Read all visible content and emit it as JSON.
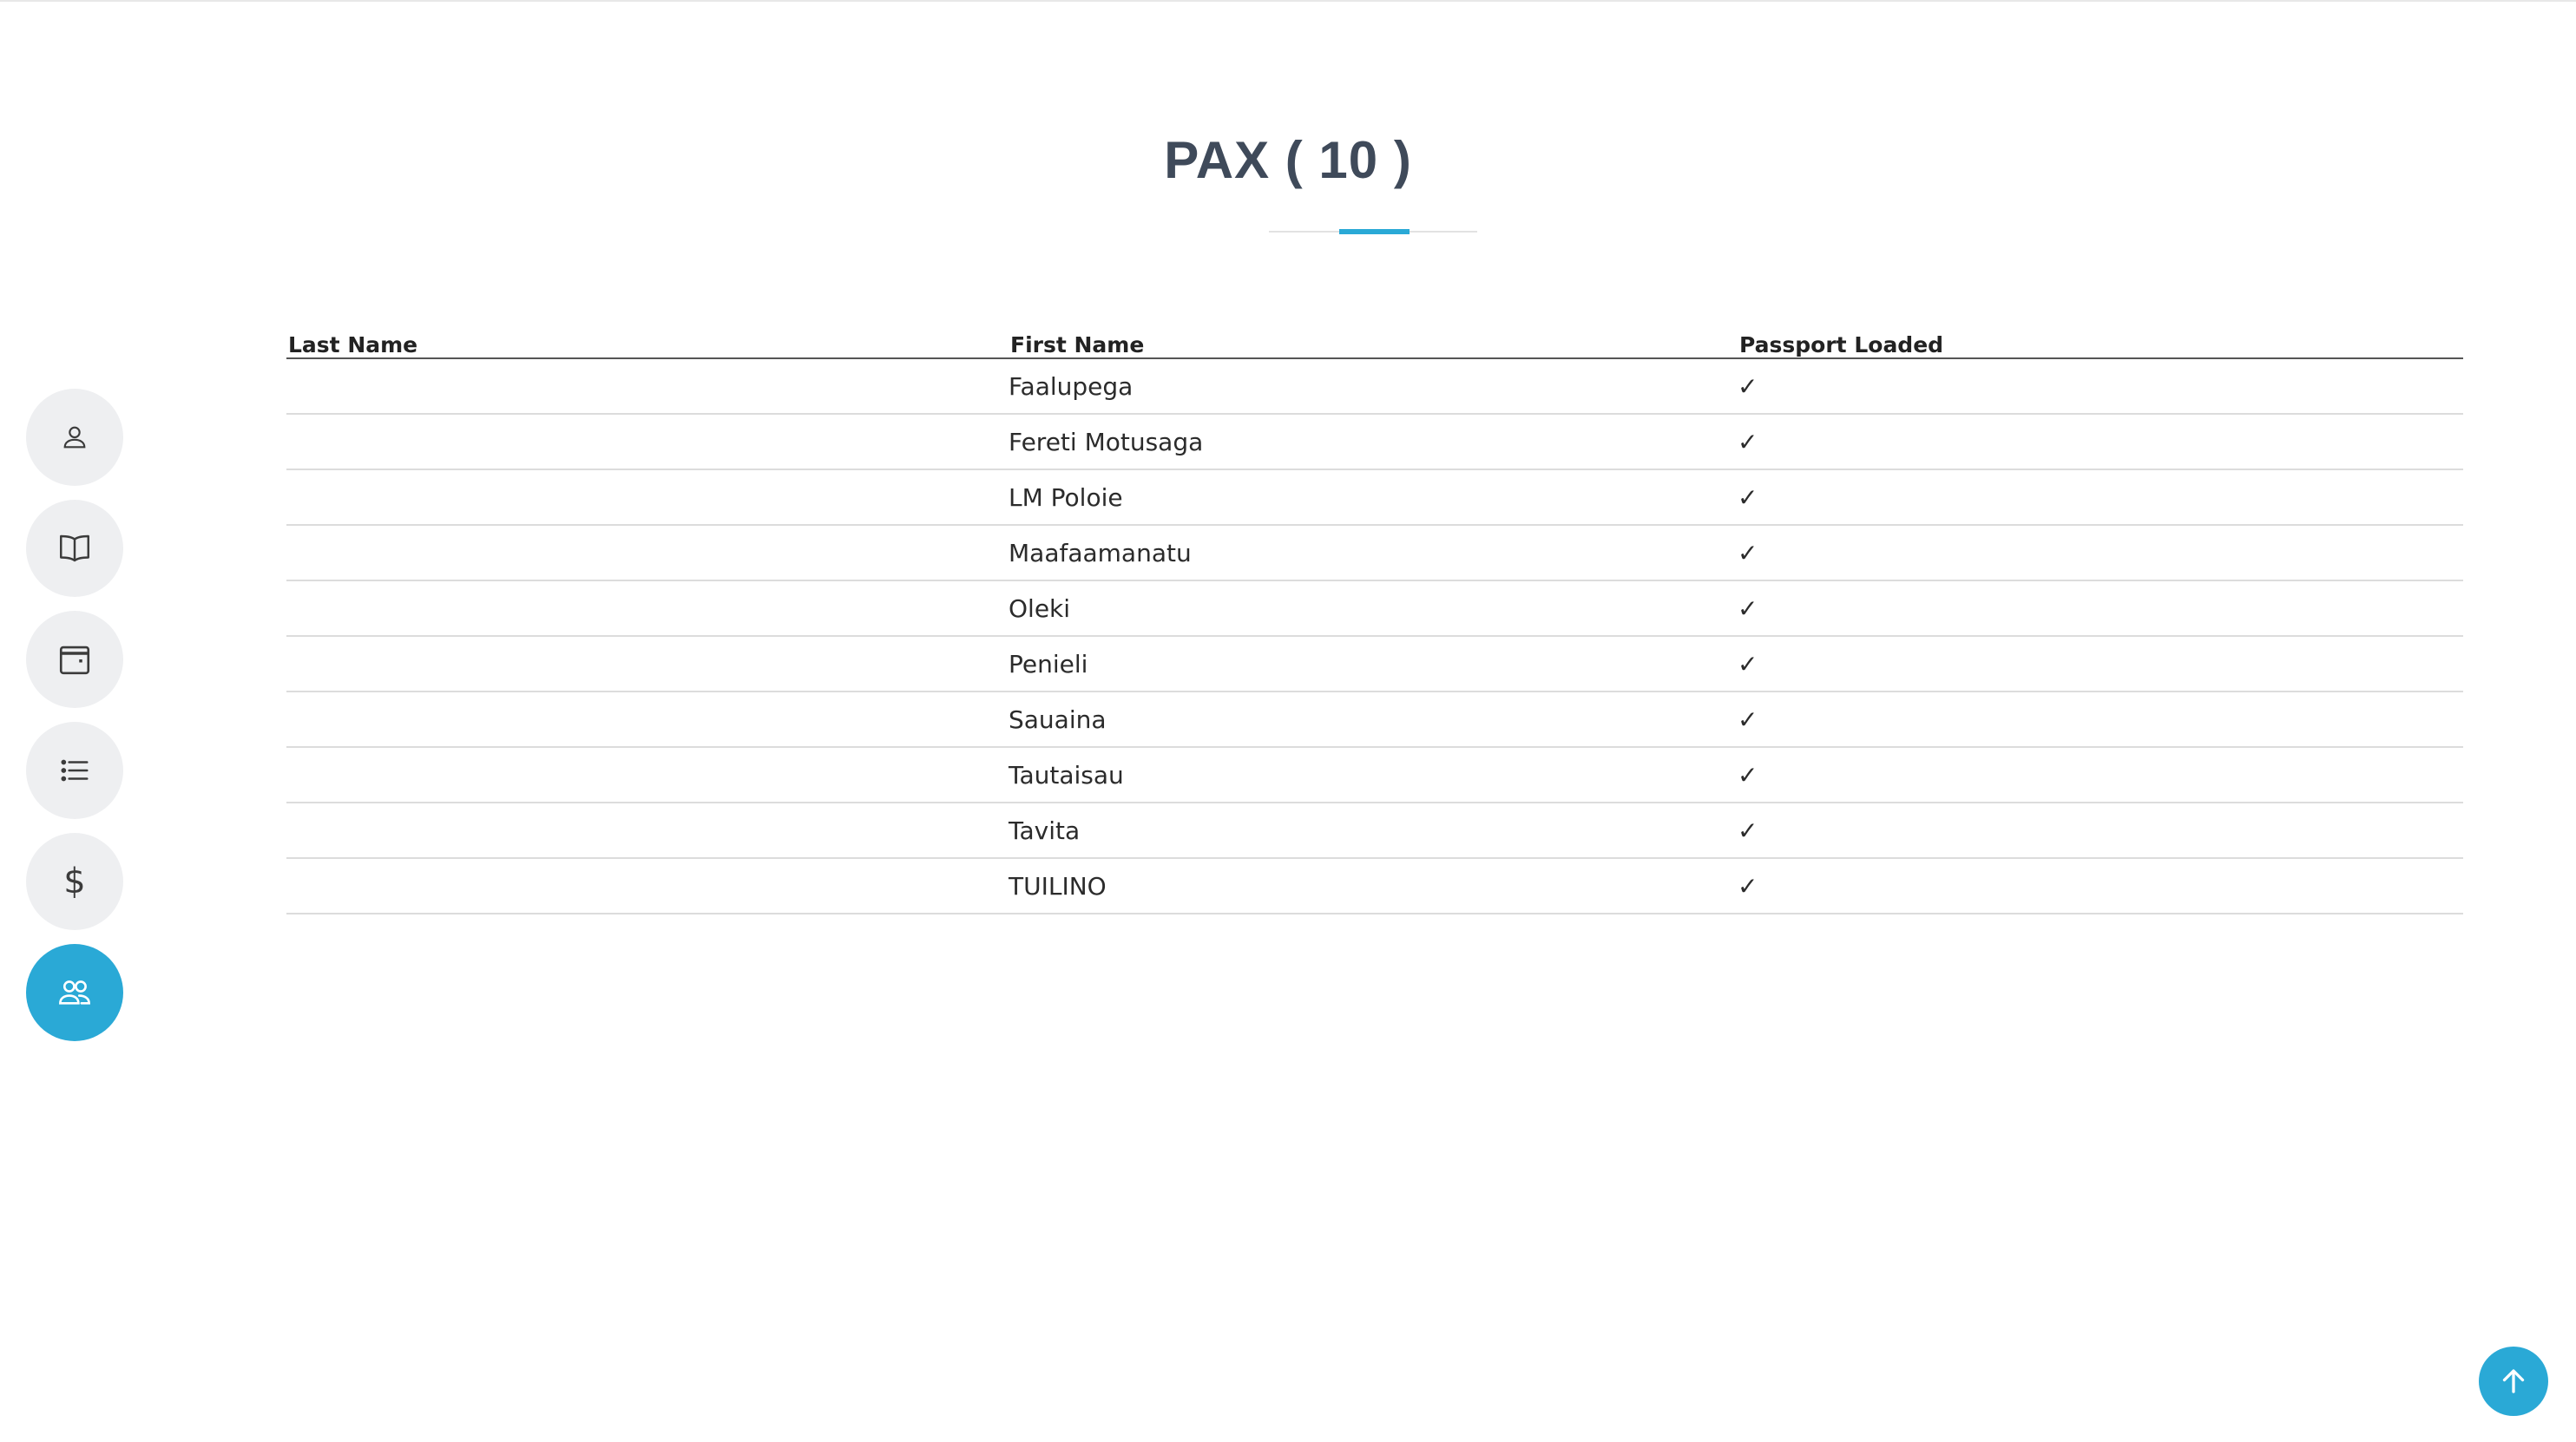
{
  "page": {
    "title": "PAX ( 10 )"
  },
  "sidebar": {
    "items": [
      {
        "icon": "user-icon",
        "active": false
      },
      {
        "icon": "book-icon",
        "active": false
      },
      {
        "icon": "calendar-icon",
        "active": false
      },
      {
        "icon": "list-icon",
        "active": false
      },
      {
        "icon": "dollar-icon",
        "label": "$",
        "active": false
      },
      {
        "icon": "group-icon",
        "active": true
      }
    ]
  },
  "table": {
    "headers": [
      "Last Name",
      "First Name",
      "Passport Loaded"
    ],
    "rows": [
      {
        "last_name": "",
        "first_name": "Faalupega",
        "passport": "✓"
      },
      {
        "last_name": "",
        "first_name": "Fereti Motusaga",
        "passport": "✓"
      },
      {
        "last_name": "",
        "first_name": "LM Poloie",
        "passport": "✓"
      },
      {
        "last_name": "",
        "first_name": "Maafaamanatu",
        "passport": "✓"
      },
      {
        "last_name": "",
        "first_name": "Oleki",
        "passport": "✓"
      },
      {
        "last_name": "",
        "first_name": "Penieli",
        "passport": "✓"
      },
      {
        "last_name": "",
        "first_name": "Sauaina",
        "passport": "✓"
      },
      {
        "last_name": "",
        "first_name": "Tautaisau",
        "passport": "✓"
      },
      {
        "last_name": "",
        "first_name": "Tavita",
        "passport": "✓"
      },
      {
        "last_name": "",
        "first_name": "TUILINO",
        "passport": "✓"
      }
    ]
  },
  "colors": {
    "accent": "#2aa9d6",
    "title": "#3f4a5a",
    "sidebar_bg": "#eeeff1"
  },
  "scroll_top": {
    "icon": "arrow-up-icon"
  }
}
